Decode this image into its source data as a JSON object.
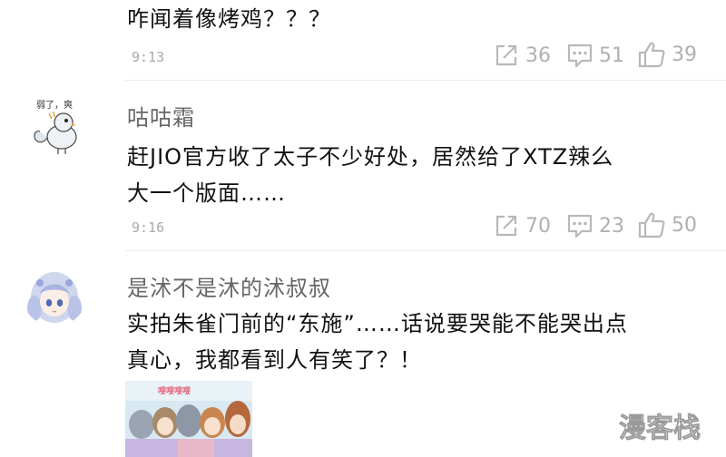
{
  "comments": [
    {
      "text": "咋闻着像烤鸡？？？",
      "time": "9:13",
      "shares": "36",
      "replies": "51",
      "likes": "39"
    },
    {
      "username": "咕咕霜",
      "avatar_caption": "弱了，爽",
      "text_line1": "赶JIO官方收了太子不少好处，居然给了XTZ辣么",
      "text_line2": "大一个版面……",
      "time": "9:16",
      "shares": "70",
      "replies": "23",
      "likes": "50"
    },
    {
      "username": "是沭不是沐的沭叔叔",
      "text_line1": "实拍朱雀门前的“东施”……话说要哭能不能哭出点",
      "text_line2": "真心，我都看到人有笑了？！",
      "image_caption": "嘤嘤嘤嘤"
    }
  ],
  "watermark": {
    "text": "漫客栈"
  },
  "icons": {
    "share": "share-icon",
    "reply": "comment-icon",
    "like": "thumbs-up-icon"
  },
  "colors": {
    "text": "#111111",
    "muted": "#aaaaaa",
    "icon": "#b0b0b0",
    "watermark": "#ffffff"
  }
}
